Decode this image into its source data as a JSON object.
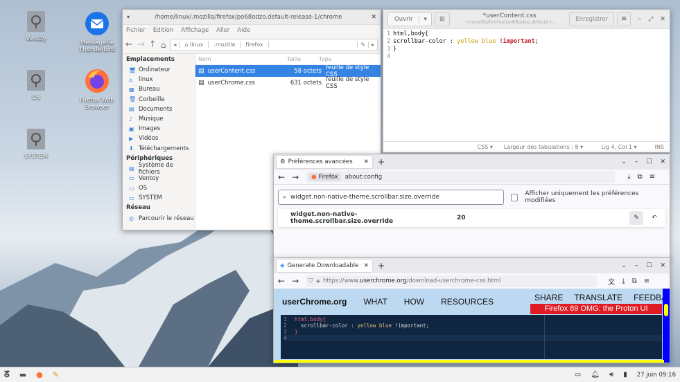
{
  "desktop": {
    "icons": [
      {
        "label": "Ventoy"
      },
      {
        "label": "Messagerie\nThunderbird"
      },
      {
        "label": "OS"
      },
      {
        "label": "Firefox Web\nBrowser"
      },
      {
        "label": "SYSTEM"
      }
    ]
  },
  "files": {
    "title": "/home/linux/.mozilla/firefox/po68odzo.default-release-1/chrome",
    "menu": [
      "Fichier",
      "Édition",
      "Affichage",
      "Aller",
      "Aide"
    ],
    "path": [
      "linux",
      ".mozilla",
      "firefox"
    ],
    "sidebar": {
      "places_title": "Emplacements",
      "places": [
        "Ordinateur",
        "linux",
        "Bureau",
        "Corbeille",
        "Documents",
        "Musique",
        "Images",
        "Vidéos",
        "Téléchargements"
      ],
      "devices_title": "Périphériques",
      "devices": [
        "Système de fichiers",
        "Ventoy",
        "OS",
        "SYSTEM"
      ],
      "network_title": "Réseau",
      "network": [
        "Parcourir le réseau"
      ]
    },
    "columns": {
      "name": "Nom",
      "size": "Taille",
      "type": "Type"
    },
    "rows": [
      {
        "name": "userContent.css",
        "size": "58 octets",
        "type": "feuille de style CSS",
        "selected": true
      },
      {
        "name": "userChrome.css",
        "size": "631 octets",
        "type": "feuille de style CSS",
        "selected": false
      }
    ]
  },
  "editor": {
    "open_label": "Ouvrir",
    "title": "*userContent.css",
    "subtitle": "~/.mozilla/firefox/po68odzo.default-r...",
    "save_label": "Enregistrer",
    "lines": [
      {
        "n": "1",
        "text": "html,body{"
      },
      {
        "n": "2",
        "a": "scrollbar-color : ",
        "b": "yellow blue ",
        "c": "!important",
        "d": ";"
      },
      {
        "n": "3",
        "text": "}"
      },
      {
        "n": "4",
        "text": ""
      }
    ],
    "status": {
      "lang": "CSS",
      "tabs": "Largeur des tabulations : 8",
      "pos": "Lig 4, Col 1",
      "mode": "INS"
    }
  },
  "ff1": {
    "tab_title": "Préférences avancées",
    "identity": "Firefox",
    "url": "about:config",
    "search_value": "widget.non-native-theme.scrollbar.size.override",
    "checkbox_label": "Afficher uniquement les préférences modifiées",
    "pref_name": "widget.non-native-theme.scrollbar.size.override",
    "pref_value": "20"
  },
  "ff2": {
    "tab_title": "Generate Downloadable us",
    "url_prefix": "https://www.",
    "url_domain": "userchrome.org",
    "url_rest": "/download-userchrome-css.html",
    "site_logo": "userChrome.org",
    "nav": [
      "WHAT",
      "HOW",
      "RESOURCES"
    ],
    "top_links": [
      "SHARE",
      "TRANSLATE",
      "FEEDBACK"
    ],
    "banner": "Firefox 89 OMG: the Proton UI",
    "code": [
      {
        "n": "1",
        "text": "html,body{"
      },
      {
        "n": "2",
        "a": "  scrollbar-color : ",
        "b": "yellow blue ",
        "c": "!important;"
      },
      {
        "n": "3",
        "text": "}"
      },
      {
        "n": "4",
        "text": ""
      }
    ]
  },
  "taskbar": {
    "clock": "27 juin 09:16"
  },
  "colors": {
    "accent": "#3584e4",
    "yellow": "#ffff00",
    "blue": "#0000ff",
    "banner": "#e01b24"
  }
}
